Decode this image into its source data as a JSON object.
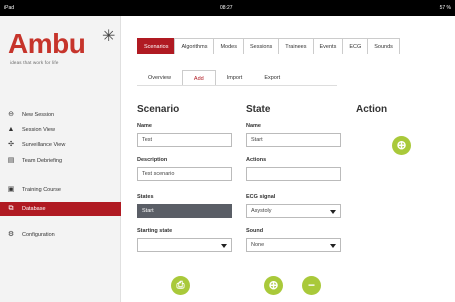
{
  "statusbar": {
    "left": "iPad",
    "time": "08:27",
    "right": "57 %"
  },
  "brand": {
    "name": "Ambu",
    "tagline": "ideas that work for life"
  },
  "sidebar": {
    "items": [
      {
        "label": "New Session",
        "icon": "new-session-icon"
      },
      {
        "label": "Session View",
        "icon": "person-icon"
      },
      {
        "label": "Surveillance View",
        "icon": "surveillance-icon"
      },
      {
        "label": "Team Debriefing",
        "icon": "clipboard-icon"
      },
      {
        "label": "Training Course",
        "icon": "training-icon"
      },
      {
        "label": "Database",
        "icon": "database-icon"
      },
      {
        "label": "Configuration",
        "icon": "configuration-icon"
      }
    ],
    "active_index": 5
  },
  "tabs": [
    "Scenarios",
    "Algorithms",
    "Modes",
    "Sessions",
    "Trainees",
    "Events",
    "ECG",
    "Sounds"
  ],
  "subtabs": [
    "Overview",
    "Add",
    "Import",
    "Export"
  ],
  "scenario": {
    "title": "Scenario",
    "name_label": "Name",
    "name_value": "Test",
    "description_label": "Description",
    "description_value": "Test scenario",
    "states_label": "States",
    "states_value": "Start",
    "starting_state_label": "Starting state",
    "starting_state_value": ""
  },
  "state": {
    "title": "State",
    "name_label": "Name",
    "name_value": "Start",
    "actions_label": "Actions",
    "actions_value": "",
    "ecg_label": "ECG signal",
    "ecg_value": "Asystoly",
    "sound_label": "Sound",
    "sound_value": "None"
  },
  "action": {
    "title": "Action"
  },
  "colors": {
    "accent": "#b01a22",
    "button_green": "#a9c93a",
    "brand_red": "#c6342b"
  }
}
